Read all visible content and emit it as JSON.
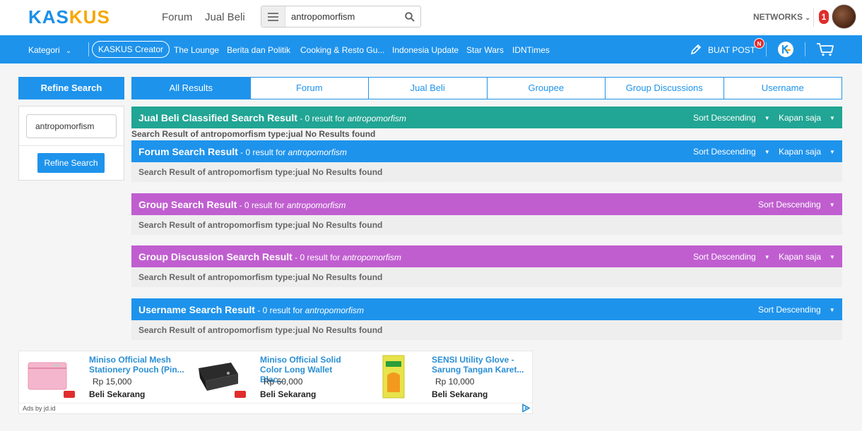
{
  "header": {
    "logo_part1": "KAS",
    "logo_part2": "KUS",
    "nav_forum": "Forum",
    "nav_jual_beli": "Jual Beli",
    "search_query": "antropomorfism",
    "networks_label": "NETWORKS",
    "notification_count": "1"
  },
  "navbar": {
    "kategori_label": "Kategori",
    "creator_label": "KASKUS Creator",
    "links": [
      "The Lounge",
      "Berita dan Politik",
      "Cooking & Resto Gu...",
      "Indonesia Update",
      "Star Wars",
      "IDNTimes"
    ],
    "buat_post_label": "BUAT POST",
    "new_badge": "N"
  },
  "sidebar": {
    "refine_title": "Refine Search",
    "refine_value": "antropomorfism",
    "refine_button": "Refine Search"
  },
  "tabs": [
    {
      "label": "All Results",
      "active": true
    },
    {
      "label": "Forum",
      "active": false
    },
    {
      "label": "Jual Beli",
      "active": false
    },
    {
      "label": "Groupee",
      "active": false
    },
    {
      "label": "Group Discussions",
      "active": false
    },
    {
      "label": "Username",
      "active": false
    }
  ],
  "results": {
    "jual_beli": {
      "title": "Jual Beli Classified Search Result",
      "sub": " - 0 result for ",
      "term": "antropomorfism",
      "sort_label": "Sort Descending",
      "time_label": "Kapan saja",
      "message": "Search Result of antropomorfism type:jual No Results found",
      "color": "#21a594"
    },
    "forum": {
      "title": "Forum Search Result",
      "sub": " - 0 result for ",
      "term": "antropomorfism",
      "sort_label": "Sort Descending",
      "time_label": "Kapan saja",
      "message": "Search Result of antropomorfism type:jual No Results found",
      "color": "#1e93ec"
    },
    "group": {
      "title": "Group Search Result",
      "sub": " - 0 result for ",
      "term": "antropomorfism",
      "sort_label": "Sort Descending",
      "message": "Search Result of antropomorfism type:jual No Results found",
      "color": "#c05ed0"
    },
    "group_discussion": {
      "title": "Group Discussion Search Result",
      "sub": " - 0 result for ",
      "term": "antropomorfism",
      "sort_label": "Sort Descending",
      "time_label": "Kapan saja",
      "message": "Search Result of antropomorfism type:jual No Results found",
      "color": "#c05ed0"
    },
    "username": {
      "title": "Username Search Result",
      "sub": " - 0 result for ",
      "term": "antropomorfism",
      "sort_label": "Sort Descending",
      "message": "Search Result of antropomorfism type:jual No Results found",
      "color": "#1e93ec"
    }
  },
  "ads": {
    "items": [
      {
        "title": "Miniso Official Mesh Stationery Pouch (Pin...",
        "price": "Rp 15,000",
        "cta": "Beli Sekarang"
      },
      {
        "title": "Miniso Official Solid Color Long Wallet Blac...",
        "price": "Rp 60,000",
        "cta": "Beli Sekarang"
      },
      {
        "title": "SENSI Utility Glove - Sarung Tangan Karet...",
        "price": "Rp 10,000",
        "cta": "Beli Sekarang"
      }
    ],
    "ads_by": "Ads by jd.id"
  }
}
